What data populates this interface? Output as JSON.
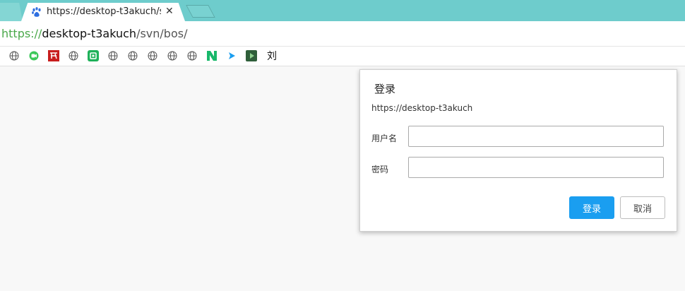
{
  "browser": {
    "tab": {
      "title": "https://desktop-t3akuch/svn/bos/",
      "close_symbol": "✕",
      "favicon": "baidu-paw-icon"
    },
    "new_tab_icon": "new-tab-icon",
    "url": {
      "scheme": "https://",
      "host": "desktop-t3akuch",
      "path": "/svn/bos/"
    },
    "bookmarks": [
      {
        "icon": "globe-icon"
      },
      {
        "icon": "green-camera-icon"
      },
      {
        "icon": "red-logo-icon"
      },
      {
        "icon": "globe-icon"
      },
      {
        "icon": "green-square-icon"
      },
      {
        "icon": "globe-icon"
      },
      {
        "icon": "globe-icon"
      },
      {
        "icon": "globe-icon"
      },
      {
        "icon": "globe-icon"
      },
      {
        "icon": "globe-icon"
      },
      {
        "icon": "green-n-icon"
      },
      {
        "icon": "blue-play-icon"
      },
      {
        "icon": "dark-play-icon"
      },
      {
        "icon": "text-glyph",
        "label": "刘"
      }
    ]
  },
  "dialog": {
    "title": "登录",
    "host": "https://desktop-t3akuch",
    "username_label": "用户名",
    "username_value": "",
    "password_label": "密码",
    "password_value": "",
    "login_button": "登录",
    "cancel_button": "取消",
    "colors": {
      "primary": "#1a9ef0",
      "border": "#aaaaaa"
    }
  },
  "colors": {
    "tabbar": "#6ecccc",
    "scheme_green": "#4aa84a"
  }
}
